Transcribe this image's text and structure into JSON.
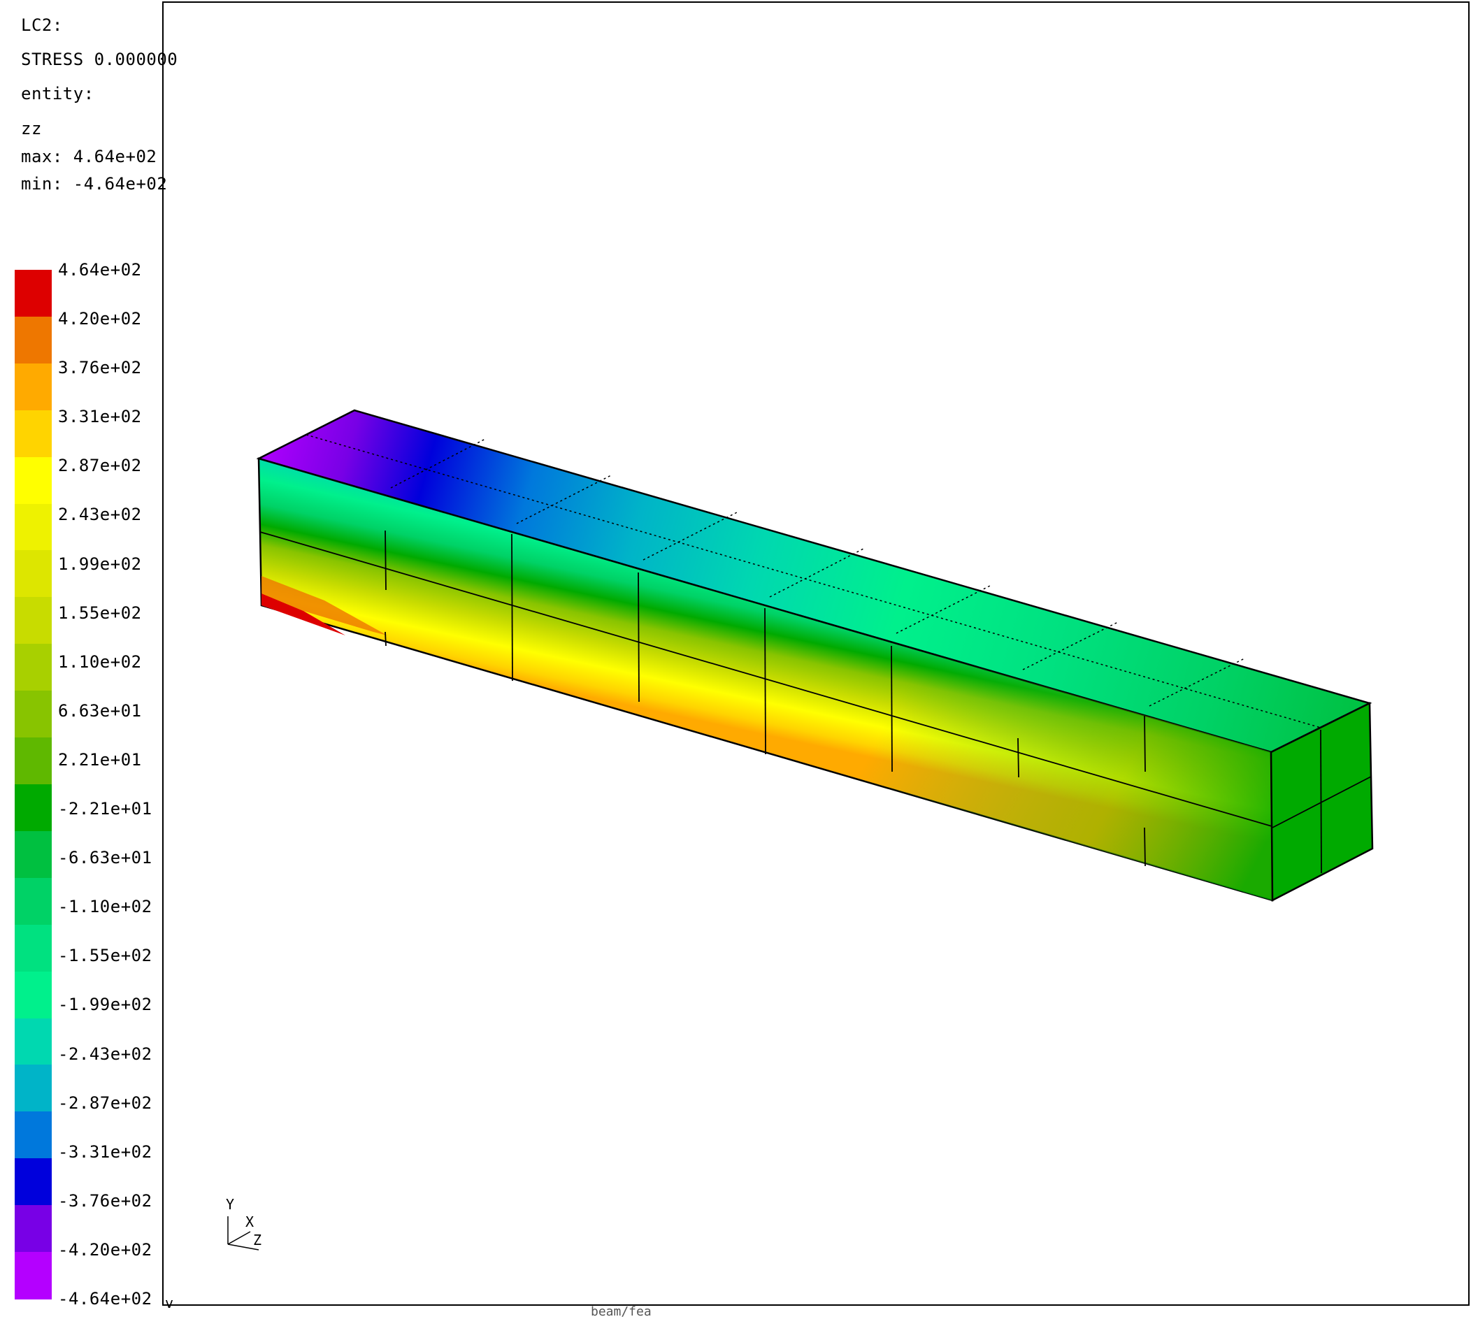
{
  "info": {
    "load_case": "LC2:",
    "result": "STRESS 0.000000",
    "entity_label": "entity:",
    "component": "zz",
    "max": "max: 4.64e+02",
    "min": "min: -4.64e+02"
  },
  "legend": {
    "labels": [
      "4.64e+02",
      "4.20e+02",
      "3.76e+02",
      "3.31e+02",
      "2.87e+02",
      "2.43e+02",
      "1.99e+02",
      "1.55e+02",
      "1.10e+02",
      "6.63e+01",
      "2.21e+01",
      "-2.21e+01",
      "-6.63e+01",
      "-1.10e+02",
      "-1.55e+02",
      "-1.99e+02",
      "-2.43e+02",
      "-2.87e+02",
      "-3.31e+02",
      "-3.76e+02",
      "-4.20e+02",
      "-4.64e+02"
    ],
    "colors": [
      "#dd0000",
      "#ee7700",
      "#ffaa00",
      "#ffd400",
      "#ffff00",
      "#eef200",
      "#dde600",
      "#c8dc00",
      "#a8d000",
      "#88c400",
      "#5fb800",
      "#00aa00",
      "#00c040",
      "#00d266",
      "#00e180",
      "#00f08c",
      "#00d8b0",
      "#00b4c8",
      "#0078dc",
      "#0000dc",
      "#7800e6",
      "#b400ff"
    ]
  },
  "triad": {
    "y": "Y",
    "x": "X",
    "z": "Z"
  },
  "corner_mark": "v",
  "caption_stub": "beam/fea"
}
